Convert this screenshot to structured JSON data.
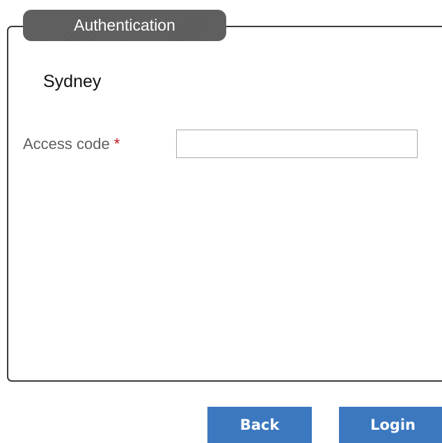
{
  "auth_box": {
    "legend": "Authentication",
    "site_name": "Sydney",
    "access_code": {
      "label": "Access code",
      "required_marker": "*",
      "value": "",
      "placeholder": ""
    }
  },
  "actions": {
    "back_label": "Back",
    "login_label": "Login"
  },
  "colors": {
    "button_background": "#3b78c0",
    "legend_background": "#5b5b5b",
    "required_marker": "#c0161b"
  }
}
